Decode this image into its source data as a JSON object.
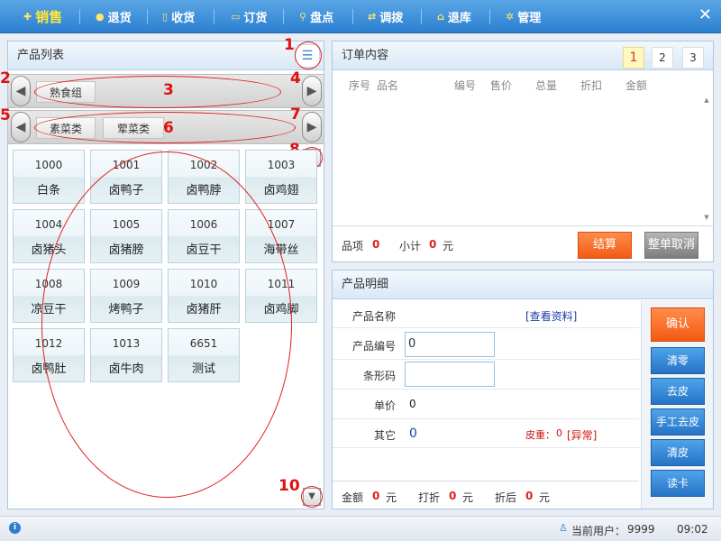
{
  "nav": {
    "items": [
      {
        "label": "销售",
        "icon": "plus-icon"
      },
      {
        "label": "退货",
        "icon": "minus-icon"
      },
      {
        "label": "收货",
        "icon": "document-icon"
      },
      {
        "label": "订货",
        "icon": "comment-icon"
      },
      {
        "label": "盘点",
        "icon": "search-icon"
      },
      {
        "label": "调拨",
        "icon": "transfer-icon"
      },
      {
        "label": "退库",
        "icon": "home-icon"
      },
      {
        "label": "管理",
        "icon": "gear-icon"
      }
    ],
    "close": "✕"
  },
  "product_list": {
    "title": "产品列表",
    "category_groups": [
      "熟食组"
    ],
    "subcategories": [
      "素菜类",
      "荤菜类"
    ],
    "products": [
      {
        "code": "1000",
        "name": "白条"
      },
      {
        "code": "1001",
        "name": "卤鸭子"
      },
      {
        "code": "1002",
        "name": "卤鸭脖"
      },
      {
        "code": "1003",
        "name": "卤鸡翅"
      },
      {
        "code": "1004",
        "name": "卤猪头"
      },
      {
        "code": "1005",
        "name": "卤猪膀"
      },
      {
        "code": "1006",
        "name": "卤豆干"
      },
      {
        "code": "1007",
        "name": "海带丝"
      },
      {
        "code": "1008",
        "name": "凉豆干"
      },
      {
        "code": "1009",
        "name": "烤鸭子"
      },
      {
        "code": "1010",
        "name": "卤猪肝"
      },
      {
        "code": "1011",
        "name": "卤鸡脚"
      },
      {
        "code": "1012",
        "name": "卤鸭肚"
      },
      {
        "code": "1013",
        "name": "卤牛肉"
      },
      {
        "code": "6651",
        "name": "测试"
      }
    ]
  },
  "annotations": [
    "1",
    "2",
    "3",
    "4",
    "5",
    "6",
    "7",
    "8",
    "10"
  ],
  "orders": {
    "title": "订单内容",
    "pages": [
      "1",
      "2",
      "3"
    ],
    "columns": [
      "序号",
      "品名",
      "编号",
      "售价",
      "总量",
      "折扣",
      "金额"
    ],
    "items_label": "品项",
    "items_count": "0",
    "subtotal_label": "小计",
    "subtotal": "0",
    "unit": "元",
    "checkout": "结算",
    "cancel_all": "整单取消"
  },
  "detail": {
    "title": "产品明细",
    "name_label": "产品名称",
    "view_info": "[查看资料]",
    "code_label": "产品编号",
    "code_value": "0",
    "barcode_label": "条形码",
    "barcode_value": "",
    "price_label": "单价",
    "price_value": "0",
    "other_label": "其它",
    "other_value": "0",
    "tare_label": "皮重：",
    "tare_value": "0",
    "abnormal": "[异常]",
    "amount_label": "金额",
    "amount": "0",
    "discount_label": "打折",
    "discount": "0",
    "after_label": "折后",
    "after": "0",
    "unit": "元",
    "buttons": {
      "confirm": "确认",
      "clear": "清零",
      "tare": "去皮",
      "manual_tare": "手工去皮",
      "clear_tare": "清皮",
      "read_card": "读卡"
    }
  },
  "status": {
    "current_user_label": "当前用户：",
    "current_user": "9999",
    "time": "09:02"
  },
  "colors": {
    "nav_bg": "#2c7fd0",
    "active_nav": "#ffe838",
    "accent_orange": "#f35a14",
    "accent_blue": "#2773c6",
    "alert_red": "#e02020"
  }
}
